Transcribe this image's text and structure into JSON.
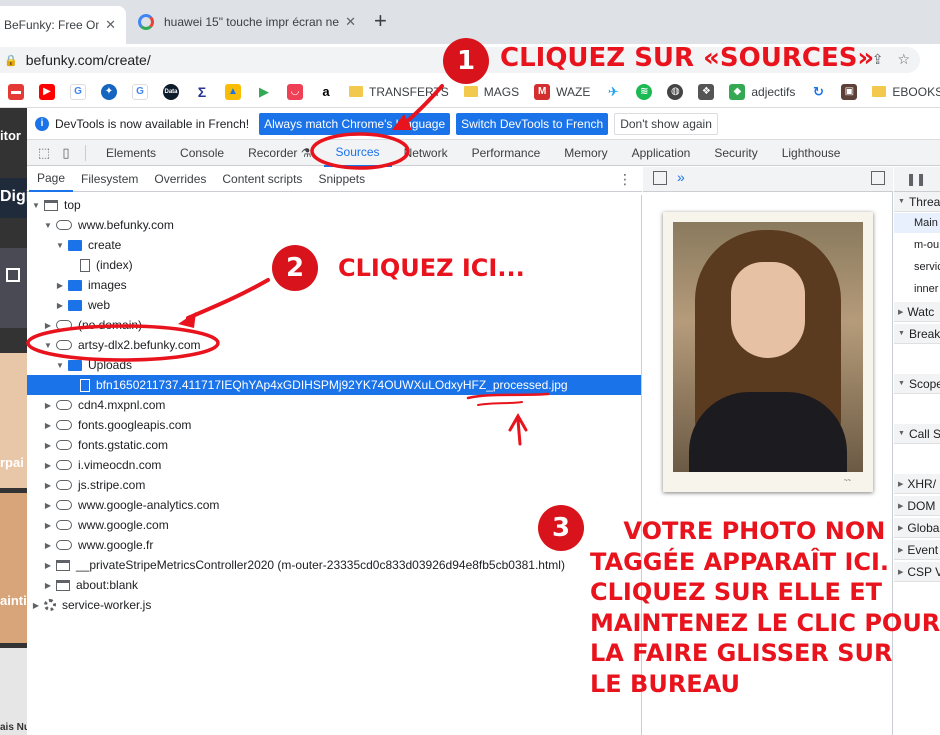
{
  "browser": {
    "tabs": [
      {
        "title": "BeFunky: Free Onli",
        "active": true
      },
      {
        "title": "huawei 15\" touche impr écran ne",
        "active": false
      }
    ],
    "new_tab_label": "+",
    "url": "befunky.com/create/",
    "bookmarks": [
      "TRANSFERTS",
      "MAGS",
      "WAZE",
      "adjectifs",
      "EBOOKS"
    ]
  },
  "page_strip": {
    "texts": [
      "itor",
      "Digi",
      "rpai",
      "aintin",
      "ais Nu"
    ]
  },
  "devtools": {
    "infobar": {
      "message": "DevTools is now available in French!",
      "match_button": "Always match Chrome's language",
      "switch_button": "Switch DevTools to French",
      "dismiss_button": "Don't show again"
    },
    "panel_tabs": [
      "Elements",
      "Console",
      "Recorder",
      "Sources",
      "Network",
      "Performance",
      "Memory",
      "Application",
      "Security",
      "Lighthouse"
    ],
    "selected_panel": "Sources",
    "navigator_tabs": [
      "Page",
      "Filesystem",
      "Overrides",
      "Content scripts",
      "Snippets"
    ],
    "tree": [
      {
        "label": "top",
        "icon": "frame"
      },
      {
        "label": "www.befunky.com",
        "icon": "cloud"
      },
      {
        "label": "create",
        "icon": "folder"
      },
      {
        "label": "(index)",
        "icon": "file"
      },
      {
        "label": "images",
        "icon": "folder"
      },
      {
        "label": "web",
        "icon": "folder"
      },
      {
        "label": "(no domain)",
        "icon": "cloud"
      },
      {
        "label": "artsy-dlx2.befunky.com",
        "icon": "cloud"
      },
      {
        "label": "Uploads",
        "icon": "folder"
      },
      {
        "label": "bfn1650211737.411717IEQhYAp4xGDIHSPMj92YK74OUWXuLOdxyHFZ_processed.jpg",
        "icon": "file",
        "selected": true
      },
      {
        "label": "cdn4.mxpnl.com",
        "icon": "cloud"
      },
      {
        "label": "fonts.googleapis.com",
        "icon": "cloud"
      },
      {
        "label": "fonts.gstatic.com",
        "icon": "cloud"
      },
      {
        "label": "i.vimeocdn.com",
        "icon": "cloud"
      },
      {
        "label": "js.stripe.com",
        "icon": "cloud"
      },
      {
        "label": "www.google-analytics.com",
        "icon": "cloud"
      },
      {
        "label": "www.google.com",
        "icon": "cloud"
      },
      {
        "label": "www.google.fr",
        "icon": "cloud"
      },
      {
        "label": "__privateStripeMetricsController2020 (m-outer-23335cd0c833d03926d94e8fb5cb0381.html)",
        "icon": "frame"
      },
      {
        "label": "about:blank",
        "icon": "frame"
      },
      {
        "label": "service-worker.js",
        "icon": "gear"
      }
    ],
    "debugger": {
      "sections": [
        "Threa",
        "Watc",
        "Break",
        "Scope",
        "Call S",
        "XHR/",
        "DOM",
        "Globa",
        "Event",
        "CSP V"
      ],
      "threads": [
        "Main",
        "m-ou",
        "servic",
        "inner"
      ]
    }
  },
  "annotations": {
    "step1_number": "1",
    "step1_text": "CLIQUEZ SUR «SOURCES»",
    "step2_number": "2",
    "step2_text": "CLIQUEZ ICI...",
    "step3_number": "3",
    "step3_lines": [
      "    VOTRE PHOTO NON",
      "TAGGÉE APPARAÎT ICI.",
      "CLIQUEZ SUR ELLE ET",
      "MAINTENEZ LE CLIC POUR",
      "LA FAIRE GLISSER SUR",
      "LE BUREAU"
    ],
    "color": "#e8131c"
  }
}
